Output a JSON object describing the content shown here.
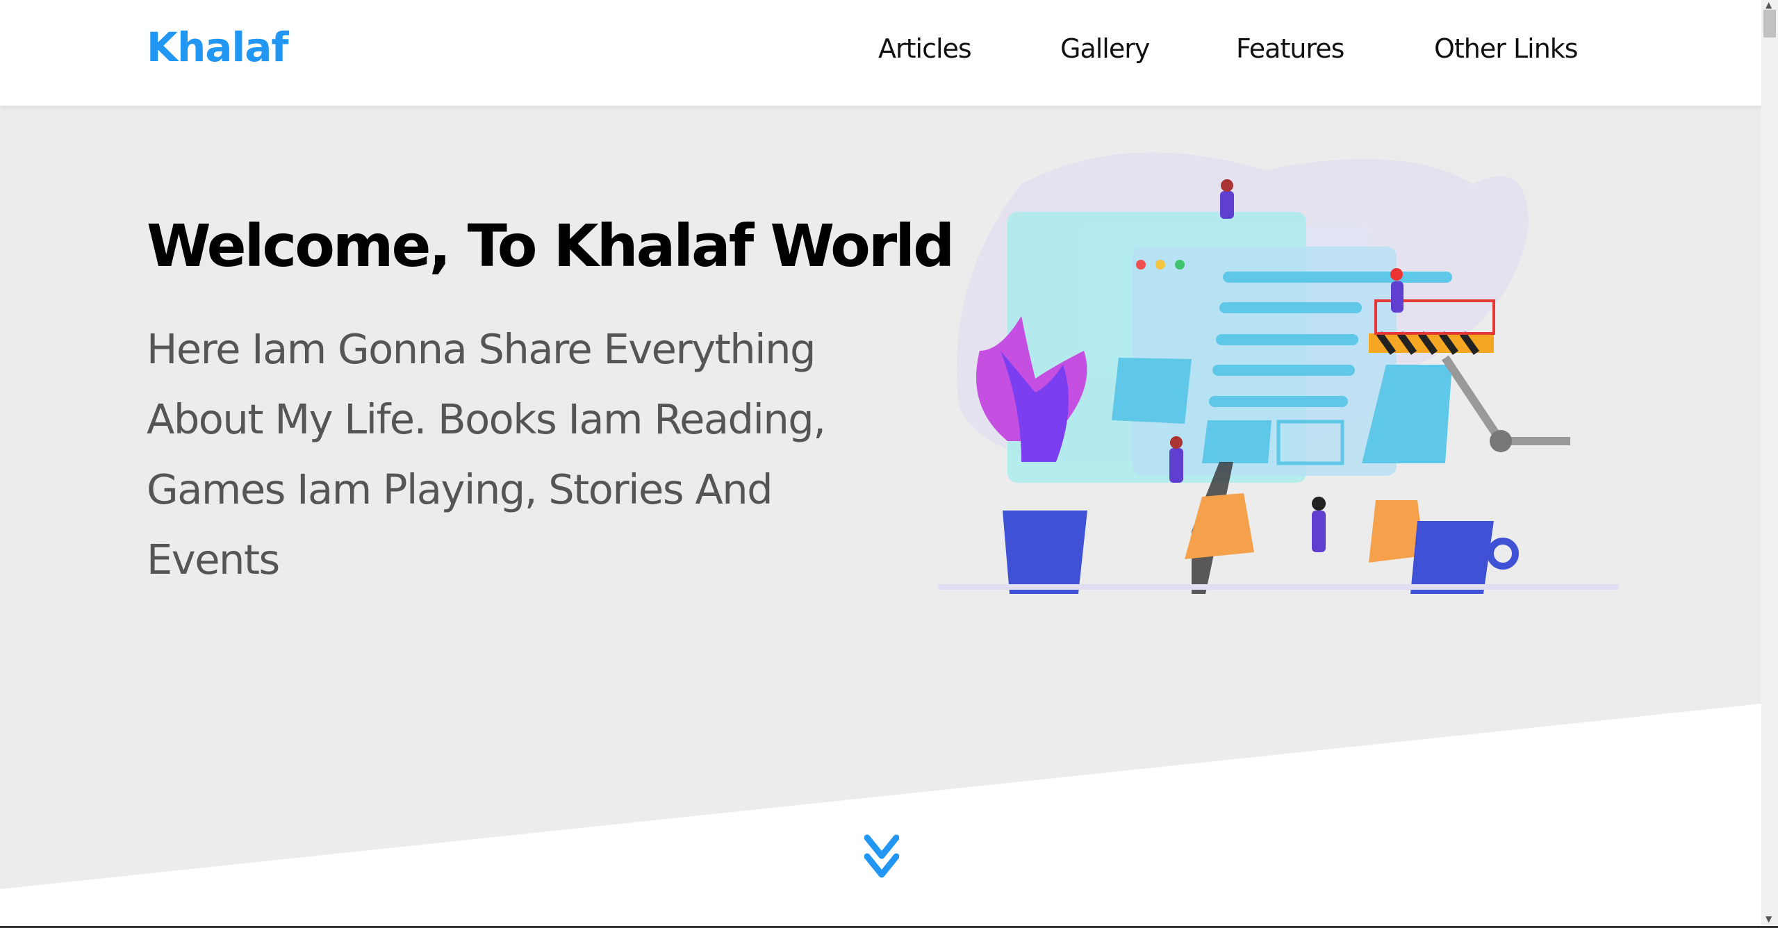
{
  "header": {
    "logo": "Khalaf",
    "nav": [
      {
        "label": "Articles"
      },
      {
        "label": "Gallery"
      },
      {
        "label": "Features"
      },
      {
        "label": "Other Links"
      }
    ]
  },
  "hero": {
    "title": "Welcome, To Khalaf World",
    "text": "Here Iam Gonna Share Everything About My Life. Books Iam Reading, Games Iam Playing, Stories And Events"
  },
  "colors": {
    "accent": "#2196f3",
    "hero_bg": "#ececec"
  },
  "icons": {
    "scroll_down": "double-chevron-down-icon"
  }
}
